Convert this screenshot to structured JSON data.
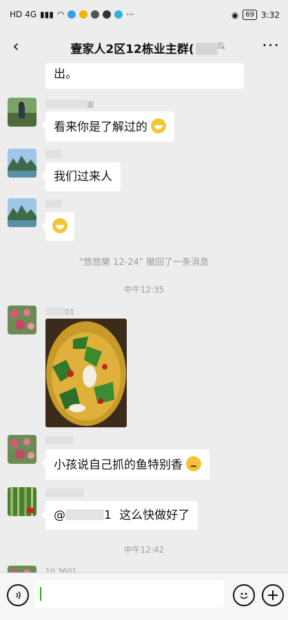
{
  "status_bar": {
    "left_text": "HD 4G",
    "battery": "69",
    "time": "3:32"
  },
  "nav": {
    "title": "壹家人2区12栋业主群(",
    "mute_icon": "bell-muted-icon",
    "more_label": "···"
  },
  "messages": [
    {
      "type": "text",
      "text": "出。"
    },
    {
      "type": "text",
      "nick_suffix": "家",
      "text": "看来你是了解过的",
      "emoji": "grin"
    },
    {
      "type": "text",
      "text": "我们过来人"
    },
    {
      "type": "emoji_only",
      "emoji": "grin"
    },
    {
      "type": "system",
      "text": "\"悠悠樂 12-24\" 撤回了一条消息"
    },
    {
      "type": "time",
      "text": "中午12:35"
    },
    {
      "type": "image",
      "nick_suffix": "01",
      "image_desc_icon": "food-photo"
    },
    {
      "type": "text",
      "text": "小孩说自己抓的鱼特别香",
      "emoji": "think"
    },
    {
      "type": "text",
      "text_prefix": "@",
      "text_blurred_suffix": "1",
      "text": "这么快做好了"
    },
    {
      "type": "time",
      "text": "中午12:42"
    },
    {
      "type": "partial",
      "nick_suffix": "10 3601"
    }
  ],
  "input_bar": {
    "voice_icon": "voice-icon",
    "emoji_icon": "emoji-icon",
    "add_icon": "plus-icon"
  },
  "colors": {
    "background": "#ededed",
    "bubble": "#ffffff",
    "caret": "#1aad19",
    "system_text": "#9b9b9b"
  }
}
